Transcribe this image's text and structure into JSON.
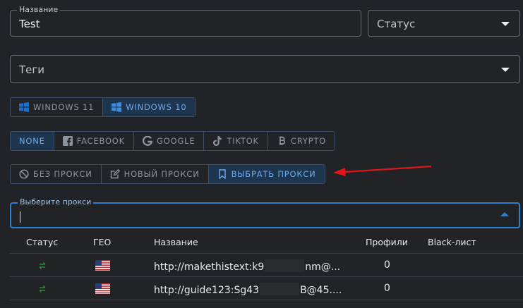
{
  "name_field": {
    "label": "Название",
    "value": "Test"
  },
  "status_field": {
    "placeholder": "Статус"
  },
  "tags_field": {
    "placeholder": "Теги"
  },
  "os_group": [
    {
      "label": "WINDOWS 11",
      "icon": "windows-icon",
      "active": false
    },
    {
      "label": "WINDOWS 10",
      "icon": "windows-icon",
      "active": true
    }
  ],
  "platform_group": [
    {
      "label": "NONE",
      "icon": "",
      "active": true
    },
    {
      "label": "FACEBOOK",
      "icon": "facebook-icon",
      "active": false
    },
    {
      "label": "GOOGLE",
      "icon": "google-icon",
      "active": false
    },
    {
      "label": "TIKTOK",
      "icon": "tiktok-icon",
      "active": false
    },
    {
      "label": "CRYPTO",
      "icon": "bitcoin-icon",
      "active": false
    }
  ],
  "proxy_group": [
    {
      "label": "БЕЗ ПРОКСИ",
      "icon": "no-entry-icon",
      "active": false
    },
    {
      "label": "НОВЫЙ ПРОКСИ",
      "icon": "edit-icon",
      "active": false
    },
    {
      "label": "ВЫБРАТЬ ПРОКСИ",
      "icon": "bookmark-icon",
      "active": true
    }
  ],
  "proxy_select": {
    "label": "Выберите прокси",
    "value": ""
  },
  "table": {
    "headers": {
      "status": "Статус",
      "geo": "ГЕО",
      "name": "Название",
      "profiles": "Профили",
      "blacklist": "Black-лист"
    },
    "rows": [
      {
        "status_icon": "sync-icon",
        "geo_icon": "us-flag-icon",
        "name_start": "http://makethistext:k9",
        "name_end": "nm@...",
        "profiles": "0",
        "blacklist": ""
      },
      {
        "status_icon": "sync-icon",
        "geo_icon": "us-flag-icon",
        "name_start": "http://guide123:Sg43",
        "name_end": "B@45....",
        "profiles": "0",
        "blacklist": ""
      }
    ]
  },
  "colors": {
    "accent": "#2f7fd1",
    "active_bg": "#1e3550",
    "arrow": "#e0161b",
    "status_green": "#2e9d3a"
  }
}
